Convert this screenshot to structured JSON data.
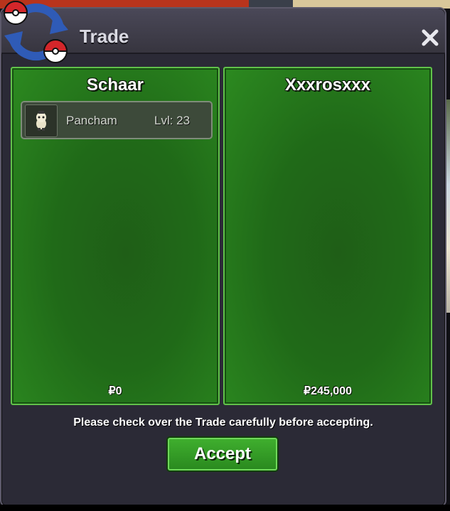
{
  "window": {
    "title": "Trade",
    "close_glyph": "✕"
  },
  "left_panel": {
    "player_name": "Schaar",
    "pokemon": [
      {
        "name": "Pancham",
        "level": "Lvl: 23",
        "icon": "pancham-sprite-icon"
      }
    ],
    "money": "₽0"
  },
  "right_panel": {
    "player_name": "Xxxrosxxx",
    "money": "₽245,000"
  },
  "footer": {
    "notice": "Please check over the Trade carefully before accepting.",
    "accept_label": "Accept"
  },
  "colors": {
    "panel_green": "#206a18",
    "panel_border": "#61c24a",
    "window_bg": "#2b2a36",
    "accept_green": "#3fae2e"
  },
  "icons": {
    "logo": "trade-pokeball-arrows-icon",
    "close": "close-icon"
  }
}
